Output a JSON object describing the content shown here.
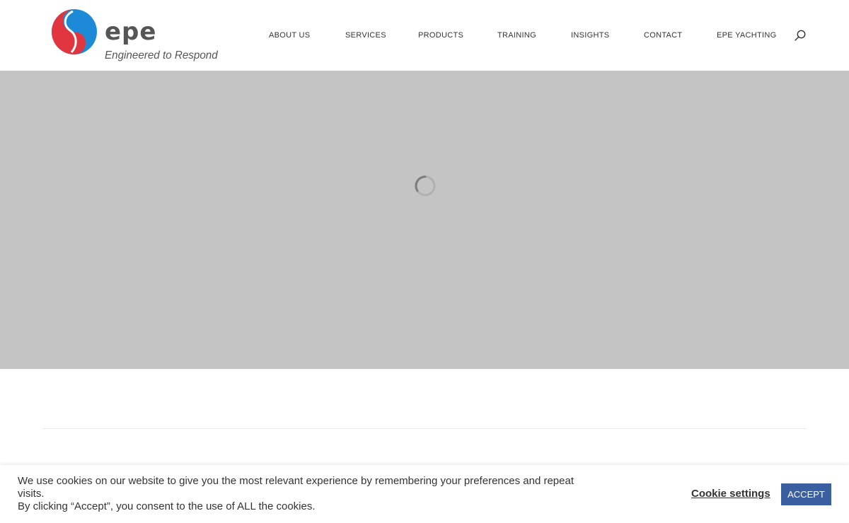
{
  "header": {
    "logo": {
      "word": "epe",
      "tagline": "Engineered to Respond"
    },
    "nav": [
      {
        "label": "ABOUT US"
      },
      {
        "label": "SERVICES"
      },
      {
        "label": "PRODUCTS"
      },
      {
        "label": "TRAINING"
      },
      {
        "label": "INSIGHTS"
      },
      {
        "label": "CONTACT"
      },
      {
        "label": "EPE YACHTING"
      }
    ],
    "search_icon": "search-icon"
  },
  "hero": {
    "background": "#c4c4c4",
    "loader_icon": "spinner-icon"
  },
  "cookie_banner": {
    "line1": "We use cookies on our website to give you the most relevant experience by remembering your preferences and repeat visits.",
    "line2": "By clicking “Accept”, you consent to the use of ALL the cookies.",
    "settings_label": "Cookie settings",
    "accept_label": "ACCEPT"
  },
  "colors": {
    "brand_red": "#e1353f",
    "brand_blue": "#1d8ad8",
    "accept_button": "#3a5fa0",
    "hero_placeholder": "#c4c4c4"
  }
}
